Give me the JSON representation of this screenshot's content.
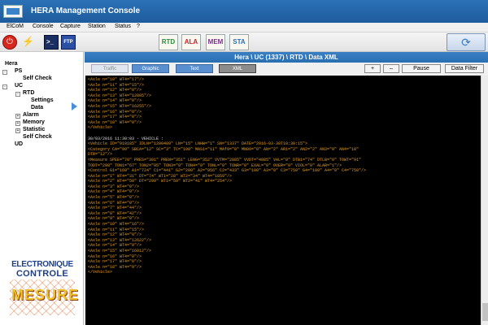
{
  "window": {
    "title": "HERA Management Console"
  },
  "menu": [
    "ElCoM",
    "Console",
    "Capture",
    "Station",
    "Status",
    "?"
  ],
  "toolbar": {
    "ftp_label": "FTP",
    "modes": [
      "RTD",
      "ALA",
      "MEM",
      "STA"
    ]
  },
  "tree": {
    "root": "Hera",
    "ps": "PS",
    "ps_self_check": "Self Check",
    "uc": "UC",
    "rtd": "RTD",
    "settings": "Settings",
    "data": "Data",
    "alarm": "Alarm",
    "memory": "Memory",
    "statistic": "Statistic",
    "uc_self_check": "Self Check",
    "ud": "UD"
  },
  "logo": {
    "line1": "ELECTRONIQUE",
    "line2": "CONTROLE",
    "line3": "MESURE"
  },
  "main": {
    "header": "Hera \\ UC (1337) \\ RTD \\ Data XML",
    "tabs": [
      "Traffic",
      "Graphic",
      "Text",
      "XML"
    ],
    "plus": "+",
    "minus": "–",
    "pause": "Pause",
    "data_filter": "Data Filter"
  },
  "console": {
    "lines_top": [
      "<Axle n=\"10\" WT4=\"17\"/>",
      "<Axle n=\"11\" WT4=\"15\"/>",
      "<Axle n=\"12\" WT4=\"0\"/>",
      "<Axle n=\"13\" WT4=\"12805\"/>",
      "<Axle n=\"14\" WT4=\"0\"/>",
      "<Axle n=\"15\" WT4=\"16255\"/>",
      "<Axle n=\"16\" WT4=\"0\"/>",
      "<Axle n=\"17\" WT4=\"0\"/>",
      "<Axle n=\"18\" WT4=\"0\"/>",
      "</Vehicle>"
    ],
    "timestamp": "30/03/2016 11:30:03 - VEHICLE :",
    "lines_bottom": [
      "<Vehicle ID=\"919185\" IDLN=\"1200409\" LN=\"15\" LNHW=\"1\" SN=\"1337\" DATE=\"2016-03-30T10:30:15\">",
      "<Category CA=\"99\" SBCA=\"12\" SC=\"3\" TC=\"100\" MAS1=\"11\" MAf9=\"0\" MN09=\"0\" AN=\"2\" AR1=\"2\" AN2=\"2\" AN3=\"0\" AN4=\"18\"",
      "DTR=\"12\"/>",
      "<Measure SPEE=\"70\" PRES=\"301\" PREN=\"351\" LENG=\"352\" VVTM=\"2885\" VVDT=\"4885\" VAL=\"0\" DTB1=\"74\" DTLB=\"0\" TOWT=\"91\"",
      "TODT=\"298\" TON1=\"67\" TON2=\"95\" TON3=\"0\" TON4=\"0\" TONL=\"0\" TONR=\"0\" EXAL=\"0\" OVER=\"0\" VIOL=\"0\" ALAR=\"1\"/>",
      "<Control G1=\"160\" A1=\"724\" C1=\"441\" G2=\"200\" A2=\"956\" C2=\"433\" G3=\"100\" A3=\"0\" C3=\"750\" G4=\"100\" A4=\"0\" C4=\"750\"/>",
      "<Axle n=\"1\" WT4=\"31\" DT=\"74\" WT1=\"28\" WT2=\"34\" WT4=\"1859\"/>",
      "<Axle n=\"2\" WT4=\"50\" DT=\"299\" WT1=\"59\" WT2=\"41\" WT4=\"254\"/>",
      "<Axle n=\"3\" WT4=\"0\"/>",
      "<Axle n=\"4\" WT4=\"0\"/>",
      "<Axle n=\"5\" WT4=\"0\"/>",
      "<Axle n=\"6\" WT4=\"0\"/>",
      "<Axle n=\"7\" WT4=\"44\"/>",
      "<Axle n=\"8\" WT4=\"42\"/>",
      "<Axle n=\"9\" WT4=\"0\"/>",
      "<Axle n=\"10\" WT4=\"16\"/>",
      "<Axle n=\"11\" WT4=\"15\"/>",
      "<Axle n=\"12\" WT4=\"0\"/>",
      "<Axle n=\"13\" WT4=\"12622\"/>",
      "<Axle n=\"14\" WT4=\"0\"/>",
      "<Axle n=\"15\" WT4=\"16012\"/>",
      "<Axle n=\"16\" WT4=\"0\"/>",
      "<Axle n=\"17\" WT4=\"0\"/>",
      "<Axle n=\"18\" WT4=\"0\"/>",
      "</Vehicle>"
    ]
  },
  "colors": {
    "console_text": "#e09a2a",
    "console_bg": "#000000",
    "header_blue": "#2c71b6"
  }
}
